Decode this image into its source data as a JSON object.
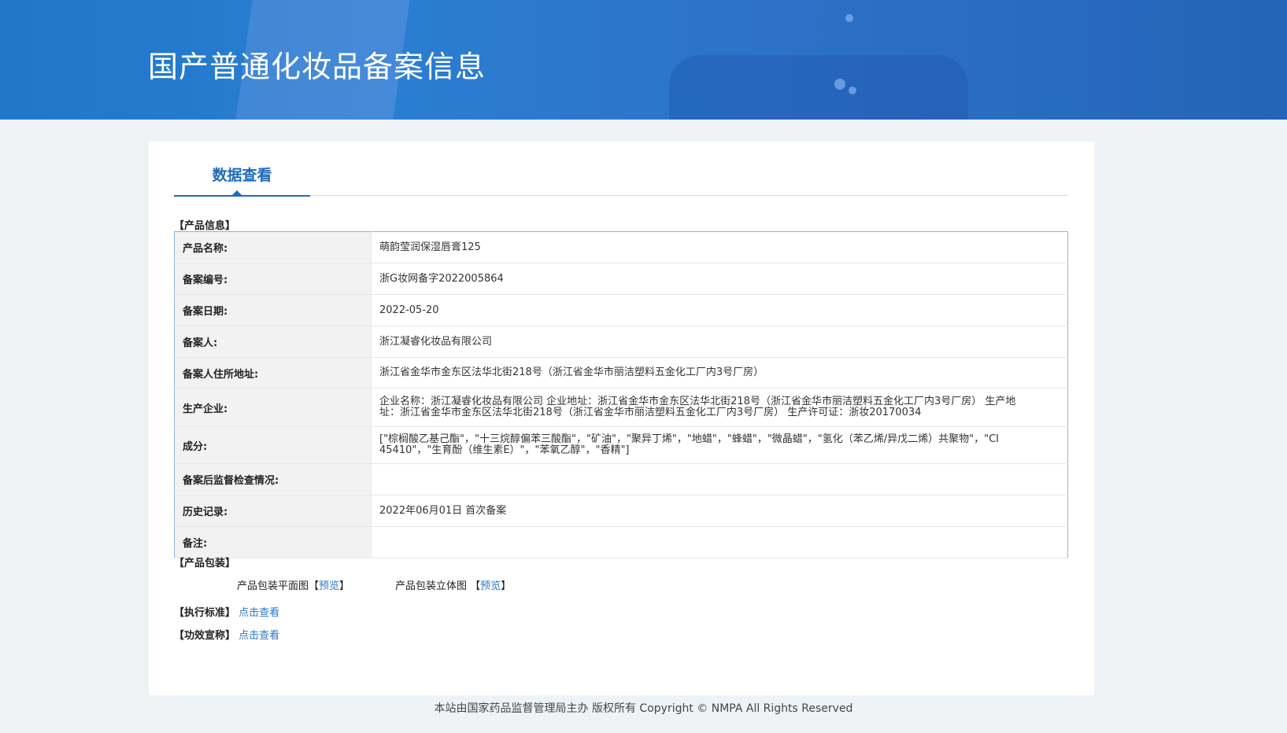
{
  "header": {
    "title": "国产普通化妆品备案信息"
  },
  "tabs": [
    {
      "label": "数据查看"
    }
  ],
  "product_info": {
    "section_title": "【产品信息】",
    "rows": [
      {
        "key": "产品名称:",
        "value": "萌韵莹润保湿唇膏125"
      },
      {
        "key": "备案编号:",
        "value": "浙G妆网备字2022005864"
      },
      {
        "key": "备案日期:",
        "value": "2022-05-20"
      },
      {
        "key": "备案人:",
        "value": "浙江凝睿化妆品有限公司"
      },
      {
        "key": "备案人住所地址:",
        "value": "浙江省金华市金东区法华北街218号（浙江省金华市丽洁塑料五金化工厂内3号厂房）"
      },
      {
        "key": "生产企业:",
        "value": "企业名称：浙江凝睿化妆品有限公司 企业地址：浙江省金华市金东区法华北街218号（浙江省金华市丽洁塑料五金化工厂内3号厂房） 生产地址：浙江省金华市金东区法华北街218号（浙江省金华市丽洁塑料五金化工厂内3号厂房） 生产许可证：浙妆20170034"
      },
      {
        "key": "成分:",
        "value": "[\"棕榈酸乙基己酯\"，\"十三烷醇偏苯三酸酯\"，\"矿油\"，\"聚异丁烯\"，\"地蜡\"，\"蜂蜡\"，\"微晶蜡\"，\"氢化（苯乙烯/异戊二烯）共聚物\"，\"CI 45410\"，\"生育酚（维生素E）\"，\"苯氧乙醇\"，\"香精\"]"
      },
      {
        "key": "备案后监督检查情况:",
        "value": ""
      },
      {
        "key": "历史记录:",
        "value": "2022年06月01日 首次备案"
      },
      {
        "key": "备注:",
        "value": ""
      }
    ]
  },
  "packaging": {
    "section_title": "【产品包装】",
    "flat_label": "产品包装平面图",
    "solid_label": "产品包装立体图",
    "bracket_open": "【",
    "bracket_close": "】",
    "preview_label": "预览"
  },
  "standard": {
    "label": "【执行标准】",
    "link": "点击查看"
  },
  "efficacy": {
    "label": "【功效宣称】",
    "link": "点击查看"
  },
  "footer": {
    "text": "本站由国家药品监督管理局主办 版权所有 Copyright © NMPA All Rights Reserved"
  }
}
